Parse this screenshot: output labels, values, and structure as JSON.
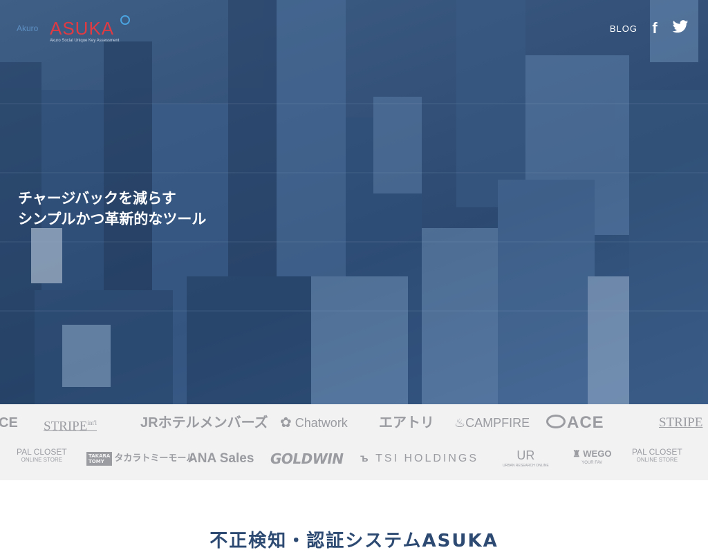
{
  "header": {
    "brand_prefix": "Akuro",
    "brand_name": "ASUKA",
    "brand_tagline": "Akuro Social Unique Key Assessment",
    "nav_blog": "BLOG",
    "facebook_icon": "facebook-icon",
    "twitter_icon": "twitter-icon"
  },
  "hero": {
    "line1": "チャージバックを減らす",
    "line2": "シンプルかつ革新的なツール",
    "background": "aerial-city-photo"
  },
  "clients": {
    "row1": [
      "CE",
      "STRIPE",
      "JRホテルメンバーズ",
      "Chatwork",
      "エアトリ",
      "CAMPFIRE",
      "ACE",
      "STRIPE"
    ],
    "stripe_suffix": "int'l",
    "row2": [
      "PAL CLOSET",
      "ONLINE STORE",
      "TAKARA",
      "TOMY",
      "タカラトミーモール",
      "ANA Sales",
      "GOLDWIN",
      "TSI HOLDINGS",
      "UR",
      "URBAN RESEARCH ONLINE",
      "WEGO",
      "YOUR FAV",
      "PAL CLOSET",
      "ONLINE STORE"
    ]
  },
  "main": {
    "section_title": "不正検知・認証システムASUKA"
  },
  "colors": {
    "hero_overlay": "#34527a",
    "brand_red": "#e03a43",
    "title_navy": "#2d4a73",
    "logo_gray": "#9a9ca1"
  }
}
